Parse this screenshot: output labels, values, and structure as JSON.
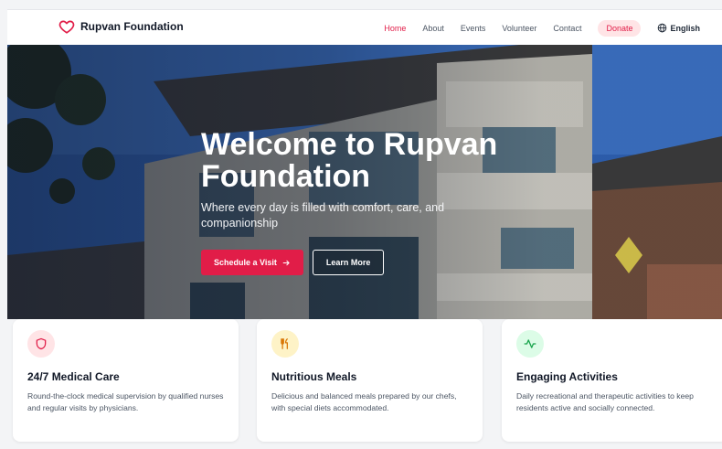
{
  "nav": {
    "brand": "Rupvan Foundation",
    "brand_icon": "heart-icon",
    "links": [
      {
        "label": "Home",
        "active": true
      },
      {
        "label": "About",
        "active": false
      },
      {
        "label": "Events",
        "active": false
      },
      {
        "label": "Volunteer",
        "active": false
      },
      {
        "label": "Contact",
        "active": false
      }
    ],
    "donate": "Donate",
    "language": "English",
    "language_icon": "globe-icon",
    "accent": "#e11d48"
  },
  "hero": {
    "title": "Welcome to Rupvan Foundation",
    "subtitle": "Where every day is filled with comfort, care, and companionship",
    "primary_button": "Schedule a Visit",
    "primary_button_icon": "arrow-right-icon",
    "secondary_button": "Learn More"
  },
  "features": [
    {
      "title": "24/7 Medical Care",
      "description": "Round-the-clock medical supervision by qualified nurses and regular visits by physicians.",
      "icon": "shield-icon",
      "icon_color": "#e11d48",
      "icon_bg": "#ffe4e6"
    },
    {
      "title": "Nutritious Meals",
      "description": "Delicious and balanced meals prepared by our chefs, with special diets accommodated.",
      "icon": "utensils-icon",
      "icon_color": "#d97706",
      "icon_bg": "#fef3c7"
    },
    {
      "title": "Engaging Activities",
      "description": "Daily recreational and therapeutic activities to keep residents active and socially connected.",
      "icon": "activity-icon",
      "icon_color": "#16a34a",
      "icon_bg": "#dcfce7"
    }
  ]
}
